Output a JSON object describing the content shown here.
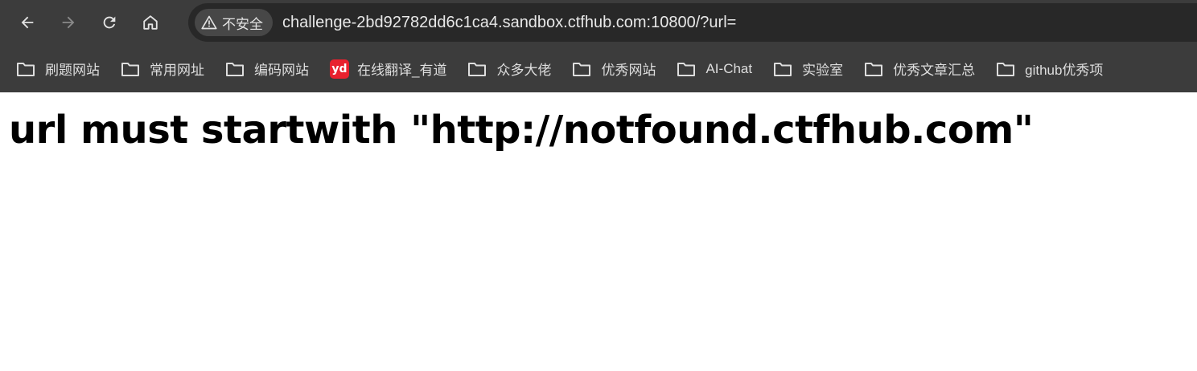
{
  "browser": {
    "security_label": "不安全",
    "url": "challenge-2bd92782dd6c1ca4.sandbox.ctfhub.com:10800/?url=",
    "icons": {
      "back": "back-arrow-icon",
      "forward": "forward-arrow-icon",
      "reload": "reload-icon",
      "home": "home-icon",
      "security": "warning-triangle-icon",
      "folder": "folder-icon",
      "youdao": "youdao-logo-icon"
    },
    "colors": {
      "chrome_bg": "#3c3c3c",
      "omnibox_bg": "#282828",
      "youdao_red": "#e8212e"
    }
  },
  "bookmarks": [
    {
      "label": "刷题网站",
      "icon": "folder-icon"
    },
    {
      "label": "常用网址",
      "icon": "folder-icon"
    },
    {
      "label": "编码网站",
      "icon": "folder-icon"
    },
    {
      "label": "在线翻译_有道",
      "icon": "youdao-logo-icon",
      "icon_text": "yd"
    },
    {
      "label": "众多大佬",
      "icon": "folder-icon"
    },
    {
      "label": "优秀网站",
      "icon": "folder-icon"
    },
    {
      "label": "AI-Chat",
      "icon": "folder-icon"
    },
    {
      "label": "实验室",
      "icon": "folder-icon"
    },
    {
      "label": "优秀文章汇总",
      "icon": "folder-icon"
    },
    {
      "label": "github优秀项",
      "icon": "folder-icon"
    }
  ],
  "page": {
    "heading": "url must startwith \"http://notfound.ctfhub.com\""
  }
}
